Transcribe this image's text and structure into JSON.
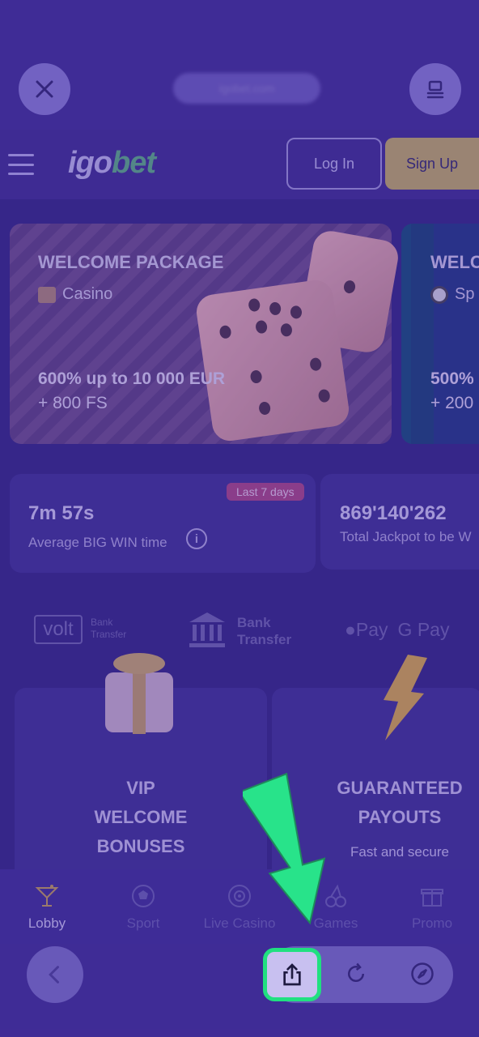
{
  "browser": {
    "close_icon": "close-icon",
    "tabs_icon": "tabs-icon",
    "url_text": "igobet.com"
  },
  "header": {
    "logo_part1": "igo",
    "logo_part2": "bet",
    "login_label": "Log In",
    "signup_label": "Sign Up"
  },
  "promos": [
    {
      "title": "WELCOME PACKAGE",
      "category": "Casino",
      "amount": "600% up to 10 000 EUR",
      "extra": "+ 800 FS"
    },
    {
      "title": "WELC",
      "category": "Sp",
      "amount": "500%",
      "extra": "+ 200"
    }
  ],
  "stats": {
    "badge": "Last 7 days",
    "big_win_time": "7m 57s",
    "big_win_label": "Average BIG WIN time",
    "jackpot_value": "869'140'262",
    "jackpot_label": "Total Jackpot to be W"
  },
  "payments": {
    "volt": "volt",
    "volt_sub1": "Bank",
    "volt_sub2": "Transfer",
    "bank1": "Bank",
    "bank2": "Transfer",
    "apple_pay": "Pay",
    "google_pay": "G Pay"
  },
  "cards": [
    {
      "line1": "VIP",
      "line2": "WELCOME",
      "line3": "BONUSES"
    },
    {
      "line1": "GUARANTEED",
      "line2": "PAYOUTS",
      "sub": "Fast and secure"
    }
  ],
  "bottom_nav": [
    {
      "label": "Lobby",
      "icon": "cocktail-icon",
      "active": true
    },
    {
      "label": "Sport",
      "icon": "soccer-ball-icon"
    },
    {
      "label": "Live Casino",
      "icon": "roulette-icon"
    },
    {
      "label": "Games",
      "icon": "cherries-icon"
    },
    {
      "label": "Promo",
      "icon": "gift-icon"
    }
  ],
  "colors": {
    "accent_green": "#20e080",
    "signup_gold": "#c8b256",
    "background": "#3a2a86"
  }
}
